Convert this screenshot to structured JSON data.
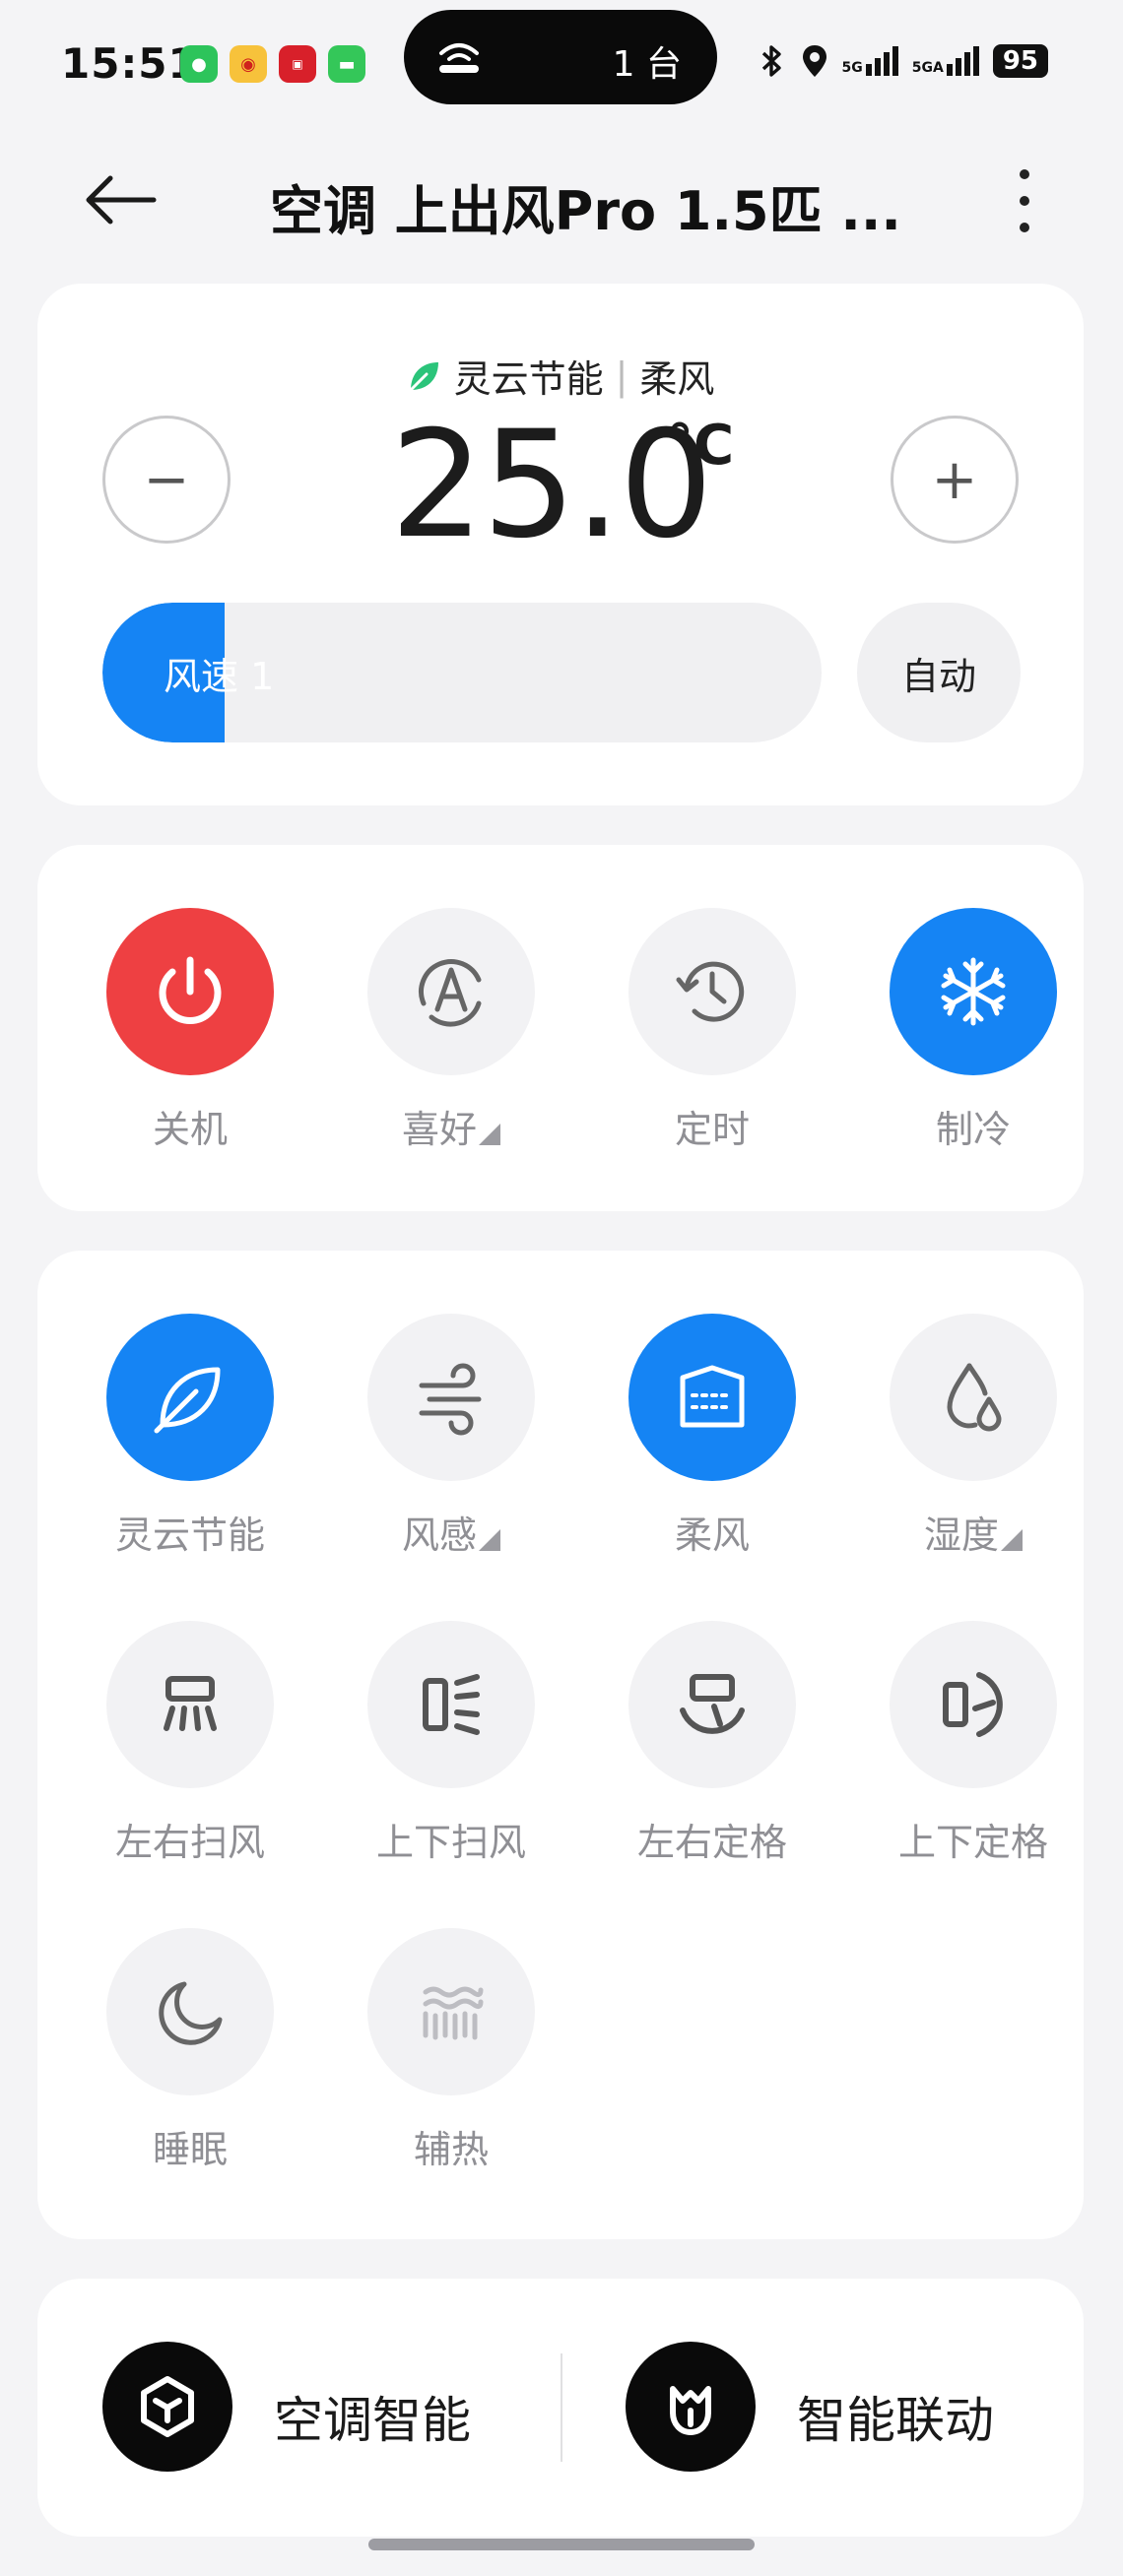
{
  "status_bar": {
    "time": "15:51",
    "island_text": "1 台",
    "signal_1": "5G",
    "signal_2": "5GA",
    "battery": "95",
    "apps": [
      "wechat-icon",
      "weibo-icon",
      "app-icon",
      "messages-icon"
    ]
  },
  "header": {
    "title": "空调 上出风Pro 1.5匹 ..."
  },
  "control": {
    "mode_primary": "灵云节能",
    "mode_secondary": "柔风",
    "temperature": "25.0",
    "unit": "°C",
    "minus_label": "−",
    "plus_label": "+",
    "fan_speed_label": "风速 1",
    "fan_speed_fill_fraction": 0.17,
    "auto_label": "自动"
  },
  "modes": [
    {
      "label": "关机",
      "icon": "power-icon",
      "state": "red"
    },
    {
      "label": "喜好",
      "icon": "preference-a-icon",
      "state": "off",
      "has_menu": true
    },
    {
      "label": "定时",
      "icon": "timer-icon",
      "state": "off"
    },
    {
      "label": "制冷",
      "icon": "snowflake-icon",
      "state": "blue"
    }
  ],
  "functions": [
    {
      "label": "灵云节能",
      "icon": "leaf-icon",
      "state": "blue"
    },
    {
      "label": "风感",
      "icon": "wind-icon",
      "state": "off",
      "has_menu": true
    },
    {
      "label": "柔风",
      "icon": "soft-wind-icon",
      "state": "blue"
    },
    {
      "label": "湿度",
      "icon": "humidity-icon",
      "state": "off",
      "has_menu": true
    },
    {
      "label": "左右扫风",
      "icon": "horizontal-swing-icon",
      "state": "off"
    },
    {
      "label": "上下扫风",
      "icon": "vertical-swing-icon",
      "state": "off"
    },
    {
      "label": "左右定格",
      "icon": "horizontal-fix-icon",
      "state": "off"
    },
    {
      "label": "上下定格",
      "icon": "vertical-fix-icon",
      "state": "off"
    },
    {
      "label": "睡眠",
      "icon": "moon-icon",
      "state": "off"
    },
    {
      "label": "辅热",
      "icon": "heat-icon",
      "state": "disabled"
    }
  ],
  "bottom": {
    "left_label": "空调智能",
    "right_label": "智能联动"
  },
  "colors": {
    "accent_blue": "#1584f4",
    "power_red": "#ee4042",
    "background": "#f4f4f6",
    "inactive_circle": "#f2f2f4"
  }
}
